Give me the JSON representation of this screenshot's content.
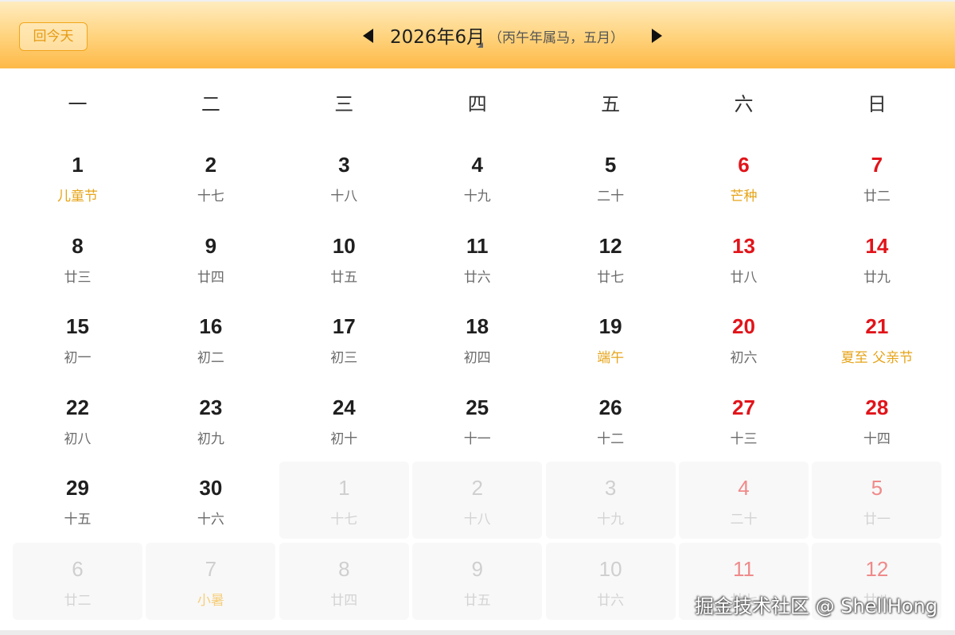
{
  "header": {
    "today_label": "回今天",
    "month_title": "2026年6月",
    "lunar_year": "（丙午年属马，五月）",
    "prev_icon": "triangle-left-icon",
    "next_icon": "triangle-right-icon"
  },
  "weekdays": [
    "一",
    "二",
    "三",
    "四",
    "五",
    "六",
    "日"
  ],
  "days": [
    {
      "num": "1",
      "sub": "儿童节",
      "weekend": false,
      "festival": true,
      "other": false
    },
    {
      "num": "2",
      "sub": "十七",
      "weekend": false,
      "festival": false,
      "other": false
    },
    {
      "num": "3",
      "sub": "十八",
      "weekend": false,
      "festival": false,
      "other": false
    },
    {
      "num": "4",
      "sub": "十九",
      "weekend": false,
      "festival": false,
      "other": false
    },
    {
      "num": "5",
      "sub": "二十",
      "weekend": false,
      "festival": false,
      "other": false
    },
    {
      "num": "6",
      "sub": "芒种",
      "weekend": true,
      "festival": true,
      "other": false
    },
    {
      "num": "7",
      "sub": "廿二",
      "weekend": true,
      "festival": false,
      "other": false
    },
    {
      "num": "8",
      "sub": "廿三",
      "weekend": false,
      "festival": false,
      "other": false
    },
    {
      "num": "9",
      "sub": "廿四",
      "weekend": false,
      "festival": false,
      "other": false
    },
    {
      "num": "10",
      "sub": "廿五",
      "weekend": false,
      "festival": false,
      "other": false
    },
    {
      "num": "11",
      "sub": "廿六",
      "weekend": false,
      "festival": false,
      "other": false
    },
    {
      "num": "12",
      "sub": "廿七",
      "weekend": false,
      "festival": false,
      "other": false
    },
    {
      "num": "13",
      "sub": "廿八",
      "weekend": true,
      "festival": false,
      "other": false
    },
    {
      "num": "14",
      "sub": "廿九",
      "weekend": true,
      "festival": false,
      "other": false
    },
    {
      "num": "15",
      "sub": "初一",
      "weekend": false,
      "festival": false,
      "other": false
    },
    {
      "num": "16",
      "sub": "初二",
      "weekend": false,
      "festival": false,
      "other": false
    },
    {
      "num": "17",
      "sub": "初三",
      "weekend": false,
      "festival": false,
      "other": false
    },
    {
      "num": "18",
      "sub": "初四",
      "weekend": false,
      "festival": false,
      "other": false
    },
    {
      "num": "19",
      "sub": "端午",
      "weekend": false,
      "festival": true,
      "other": false
    },
    {
      "num": "20",
      "sub": "初六",
      "weekend": true,
      "festival": false,
      "other": false
    },
    {
      "num": "21",
      "sub": "夏至 父亲节",
      "weekend": true,
      "festival": true,
      "other": false
    },
    {
      "num": "22",
      "sub": "初八",
      "weekend": false,
      "festival": false,
      "other": false
    },
    {
      "num": "23",
      "sub": "初九",
      "weekend": false,
      "festival": false,
      "other": false
    },
    {
      "num": "24",
      "sub": "初十",
      "weekend": false,
      "festival": false,
      "other": false
    },
    {
      "num": "25",
      "sub": "十一",
      "weekend": false,
      "festival": false,
      "other": false
    },
    {
      "num": "26",
      "sub": "十二",
      "weekend": false,
      "festival": false,
      "other": false
    },
    {
      "num": "27",
      "sub": "十三",
      "weekend": true,
      "festival": false,
      "other": false
    },
    {
      "num": "28",
      "sub": "十四",
      "weekend": true,
      "festival": false,
      "other": false
    },
    {
      "num": "29",
      "sub": "十五",
      "weekend": false,
      "festival": false,
      "other": false
    },
    {
      "num": "30",
      "sub": "十六",
      "weekend": false,
      "festival": false,
      "other": false
    },
    {
      "num": "1",
      "sub": "十七",
      "weekend": false,
      "festival": false,
      "other": true
    },
    {
      "num": "2",
      "sub": "十八",
      "weekend": false,
      "festival": false,
      "other": true
    },
    {
      "num": "3",
      "sub": "十九",
      "weekend": false,
      "festival": false,
      "other": true
    },
    {
      "num": "4",
      "sub": "二十",
      "weekend": true,
      "festival": false,
      "other": true
    },
    {
      "num": "5",
      "sub": "廿一",
      "weekend": true,
      "festival": false,
      "other": true
    },
    {
      "num": "6",
      "sub": "廿二",
      "weekend": false,
      "festival": false,
      "other": true
    },
    {
      "num": "7",
      "sub": "小暑",
      "weekend": false,
      "festival": true,
      "other": true
    },
    {
      "num": "8",
      "sub": "廿四",
      "weekend": false,
      "festival": false,
      "other": true
    },
    {
      "num": "9",
      "sub": "廿五",
      "weekend": false,
      "festival": false,
      "other": true
    },
    {
      "num": "10",
      "sub": "廿六",
      "weekend": false,
      "festival": false,
      "other": true
    },
    {
      "num": "11",
      "sub": "廿七",
      "weekend": true,
      "festival": false,
      "other": true
    },
    {
      "num": "12",
      "sub": "廿八",
      "weekend": true,
      "festival": false,
      "other": true
    }
  ],
  "watermark": "掘金技术社区 @ ShellHong"
}
